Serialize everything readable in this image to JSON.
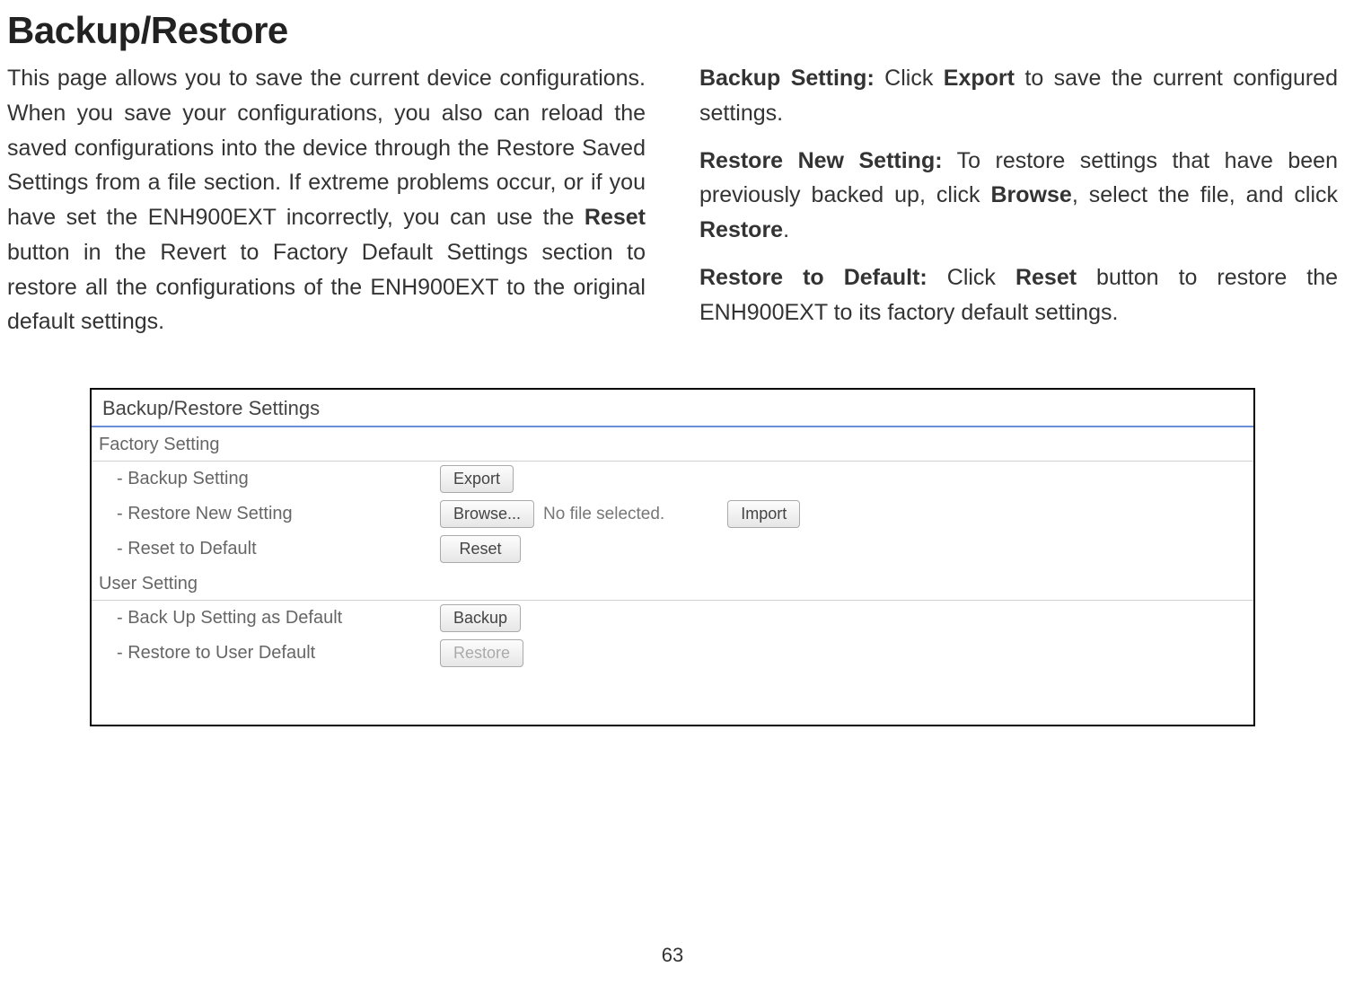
{
  "title": "Backup/Restore",
  "left": {
    "p1a": "This page allows you to save the current device configurations. When you save your configurations, you also can reload the saved configurations into the device through the Restore Saved Settings from a file section. If extreme problems occur, or if you have set the ENH900EXT incorrectly, you can use the ",
    "p1_reset": "Reset",
    "p1b": " button in the Revert to Factory Default Settings section to restore all the configurations of the ENH900EXT to the original default settings."
  },
  "right": {
    "p1_label": "Backup Setting:",
    "p1a": " Click ",
    "p1_export": "Export",
    "p1b": " to save the current configured settings.",
    "p2_label": "Restore New Setting:",
    "p2a": " To restore settings that have been previously backed up, click ",
    "p2_browse": "Browse",
    "p2b": ", select the file, and click ",
    "p2_restore": "Restore",
    "p2c": ".",
    "p3_label": "Restore to Default:",
    "p3a": " Click ",
    "p3_reset": "Reset",
    "p3b": " button to restore the ENH900EXT to its factory default settings."
  },
  "panel": {
    "title": "Backup/Restore Settings",
    "factory_header": "Factory Setting",
    "user_header": "User Setting",
    "rows": {
      "backup_setting": "- Backup Setting",
      "restore_new": "- Restore New Setting",
      "reset_default": "- Reset to Default",
      "backup_as_default": "- Back Up Setting as Default",
      "restore_user": "- Restore to User Default"
    },
    "buttons": {
      "export": "Export",
      "browse": "Browse...",
      "no_file": "No file selected.",
      "import": "Import",
      "reset": "Reset",
      "backup": "Backup",
      "restore": "Restore"
    }
  },
  "page_number": "63"
}
